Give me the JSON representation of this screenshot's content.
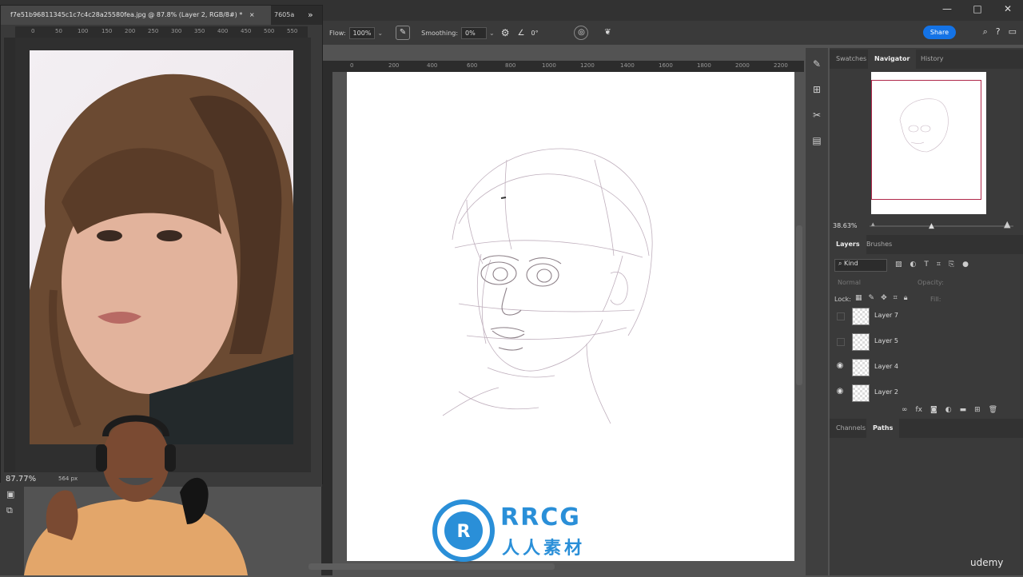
{
  "window": {
    "tab_title": "f7e51b96811345c1c7c4c28a25580fea.jpg @ 87.8% (Layer 2, RGB/8#) *",
    "tab_close": "×",
    "tab2_title": "7605a",
    "more_icon": "double-chevron-right",
    "controls": [
      "—",
      "□",
      "✕"
    ]
  },
  "options_bar": {
    "flow_label": "Flow:",
    "flow_value": "100%",
    "smoothing_label": "Smoothing:",
    "smoothing_value": "0%",
    "angle_value": "0°",
    "share_label": "Share"
  },
  "reference": {
    "zoom": "87.77%",
    "doc_info": "564 px",
    "h_ticks": [
      "0",
      "50",
      "100",
      "150",
      "200",
      "250",
      "300",
      "350",
      "400",
      "450",
      "500",
      "550"
    ]
  },
  "canvas": {
    "h_ticks": [
      "0",
      "200",
      "400",
      "600",
      "800",
      "1000",
      "1200",
      "1400",
      "1600",
      "1800",
      "2000",
      "2200"
    ]
  },
  "navigator": {
    "tabs": [
      "Swatches",
      "Navigator",
      "History"
    ],
    "active_tab": "Navigator",
    "zoom": "38.63%"
  },
  "layers_panel": {
    "tabs": [
      "Layers",
      "Brushes"
    ],
    "filter_label": "Kind",
    "blend_mode": "Normal",
    "opacity_label": "Opacity:",
    "lock_label": "Lock:",
    "fill_label": "Fill:",
    "layers": [
      {
        "name": "Layer 7",
        "visible": false
      },
      {
        "name": "Layer 5",
        "visible": false
      },
      {
        "name": "Layer 4",
        "visible": true
      },
      {
        "name": "Layer 2",
        "visible": true
      }
    ]
  },
  "bottom_panel": {
    "tabs": [
      "Channels",
      "Paths"
    ],
    "active_tab": "Paths"
  },
  "watermark": {
    "brand": "RRCG",
    "subtitle": "人人素材",
    "site": "udemy"
  },
  "colors": {
    "accent": "#1473e6",
    "nav_frame": "#b0284a",
    "watermark_blue": "#2a8fd8"
  }
}
